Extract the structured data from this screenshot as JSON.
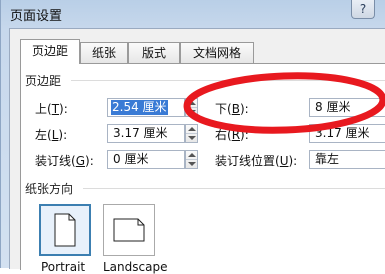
{
  "window": {
    "title": "页面设置",
    "help_glyph": "?"
  },
  "tabs": [
    {
      "label": "页边距",
      "active": true
    },
    {
      "label": "纸张",
      "active": false
    },
    {
      "label": "版式",
      "active": false
    },
    {
      "label": "文档网格",
      "active": false
    }
  ],
  "margins": {
    "section_label": "页边距",
    "top": {
      "label": "上",
      "key": "T",
      "value": "2.54 厘米",
      "selected": true
    },
    "bottom": {
      "label": "下",
      "key": "B",
      "value": "8 厘米"
    },
    "left": {
      "label": "左",
      "key": "L",
      "value": "3.17 厘米"
    },
    "right": {
      "label": "右",
      "key": "R",
      "value": "3.17 厘米"
    },
    "gutter": {
      "label": "装订线",
      "key": "G",
      "value": "0 厘米"
    },
    "gutter_position": {
      "label": "装订线位置",
      "key": "U",
      "value": "靠左"
    }
  },
  "orientation": {
    "section_label": "纸张方向",
    "portrait_label": "Portrait",
    "landscape_label": "Landscape"
  },
  "colors": {
    "annotation_circle": "#e8191f",
    "selection": "#3a7bd5",
    "selected_border": "#3c7fb1"
  }
}
